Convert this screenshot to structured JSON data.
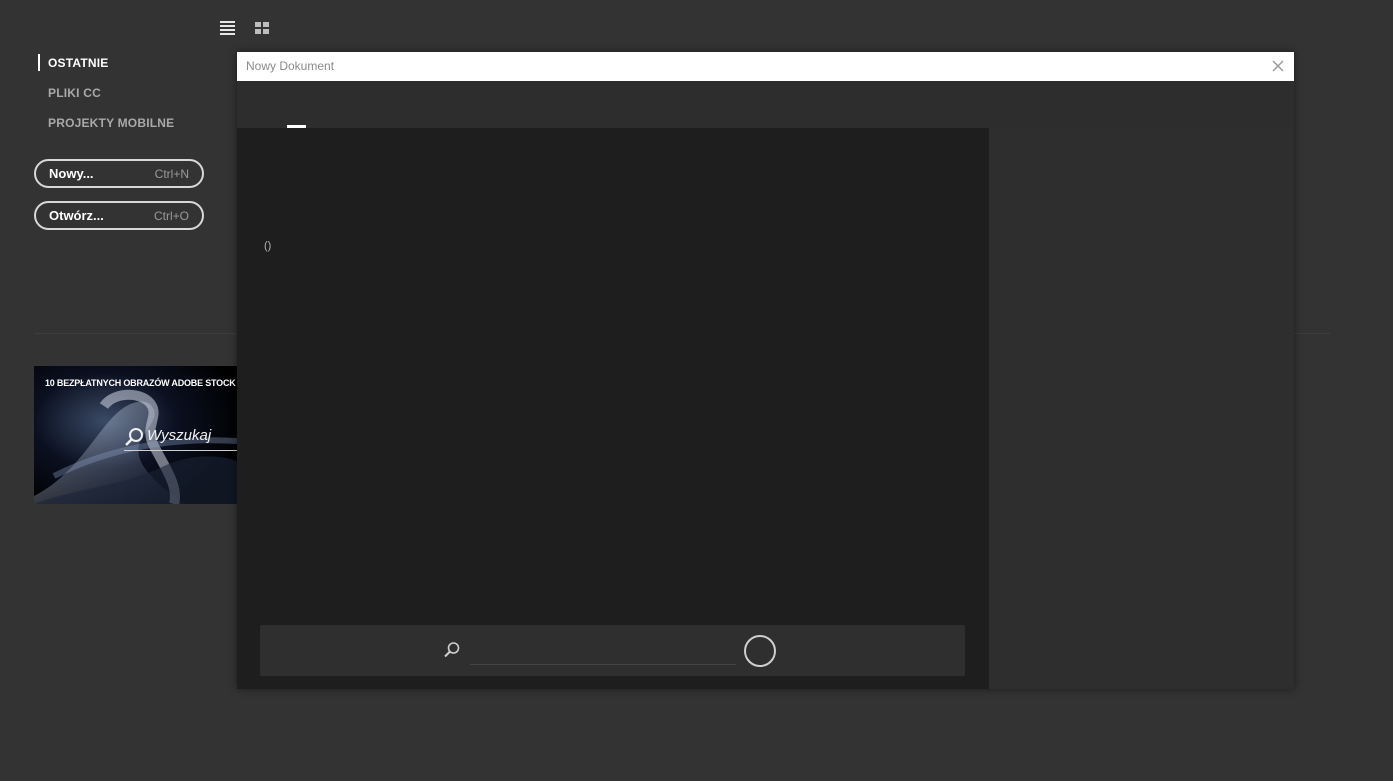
{
  "view_toggles": {
    "list_icon": "list-view-icon",
    "grid_icon": "grid-view-icon"
  },
  "nav": {
    "items": [
      {
        "label": "OSTATNIE",
        "active": true
      },
      {
        "label": "PLIKI CC",
        "active": false
      },
      {
        "label": "PROJEKTY MOBILNE",
        "active": false
      }
    ]
  },
  "actions": {
    "new": {
      "label": "Nowy...",
      "shortcut": "Ctrl+N"
    },
    "open": {
      "label": "Otwórz...",
      "shortcut": "Ctrl+O"
    }
  },
  "stock_banner": {
    "title": "10 BEZPŁATNYCH OBRAZÓW ADOBE STOCK",
    "search_label": "Wyszukaj",
    "icon": "search-icon"
  },
  "dialog": {
    "title": "Nowy Dokument",
    "close_icon": "close-icon",
    "count_text": "()",
    "search": {
      "placeholder": "",
      "value": "",
      "icon": "search-icon"
    }
  },
  "colors": {
    "background": "#333333",
    "dialog_main": "#1e1e1e",
    "dialog_side": "#2e2e2e",
    "accent": "#ffffff"
  }
}
